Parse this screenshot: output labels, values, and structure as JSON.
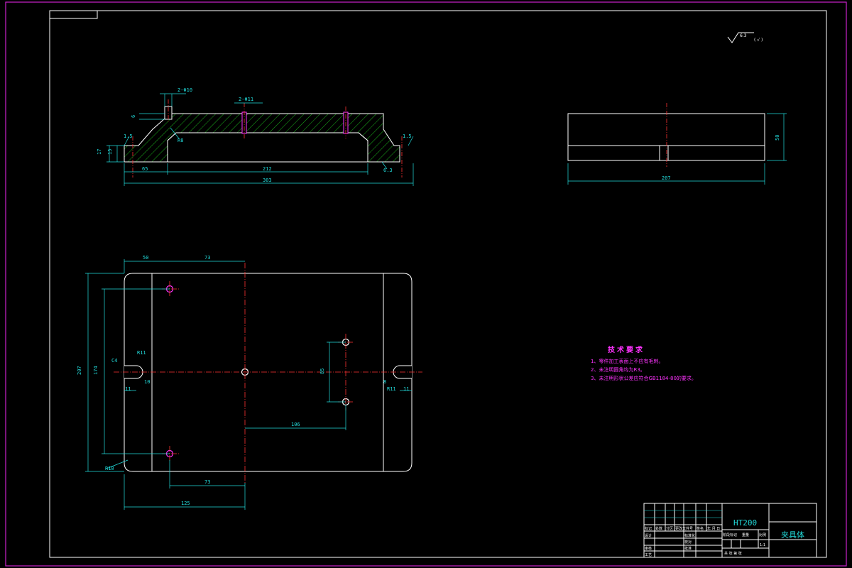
{
  "material": "HT200",
  "part_name": "夹具体",
  "surface_finish": {
    "symbol": "√",
    "value": "6.3",
    "other": "( √ )"
  },
  "tech_requirements": {
    "title": "技术要求",
    "items": [
      "1、零件加工表面上不应有毛刺。",
      "2、未注明圆角均为R3。",
      "3、未注明形状公差应符合GB1184-80的要求。"
    ]
  },
  "front_view": {
    "dims": {
      "hole_left": "2-Φ10",
      "hole_mid": "2-Φ11",
      "depth": "6",
      "left_small": "1.5",
      "h17": "17",
      "h15": "15",
      "r18": "R8",
      "w65": "65",
      "w212": "212",
      "w303": "303",
      "right_small": "1.5",
      "ra": "6.3"
    }
  },
  "side_view": {
    "dims": {
      "width": "207",
      "height": "50"
    }
  },
  "top_view": {
    "dims": {
      "d50": "50",
      "d73top": "73",
      "d207": "207",
      "d174": "174",
      "c4": "C4",
      "r11l": "R11",
      "d11l": "11",
      "d10": "10",
      "d85": "85",
      "d106": "106",
      "d73bot": "73",
      "d125": "125",
      "r10": "R10",
      "r11r": "R11",
      "d11r": "11",
      "d8": "8"
    }
  },
  "title_block": {
    "rows": [
      "标记",
      "处数",
      "分区",
      "更改文件号",
      "签名",
      "年 月 日"
    ],
    "design": "设计",
    "standard": "标准化",
    "review": "审核",
    "process": "工艺",
    "approve": "批准",
    "check": "校对",
    "stage": "阶段标记",
    "weight": "重量",
    "scale": "比例",
    "scale_val": "1:1",
    "sheets": "共  张  第  张"
  }
}
